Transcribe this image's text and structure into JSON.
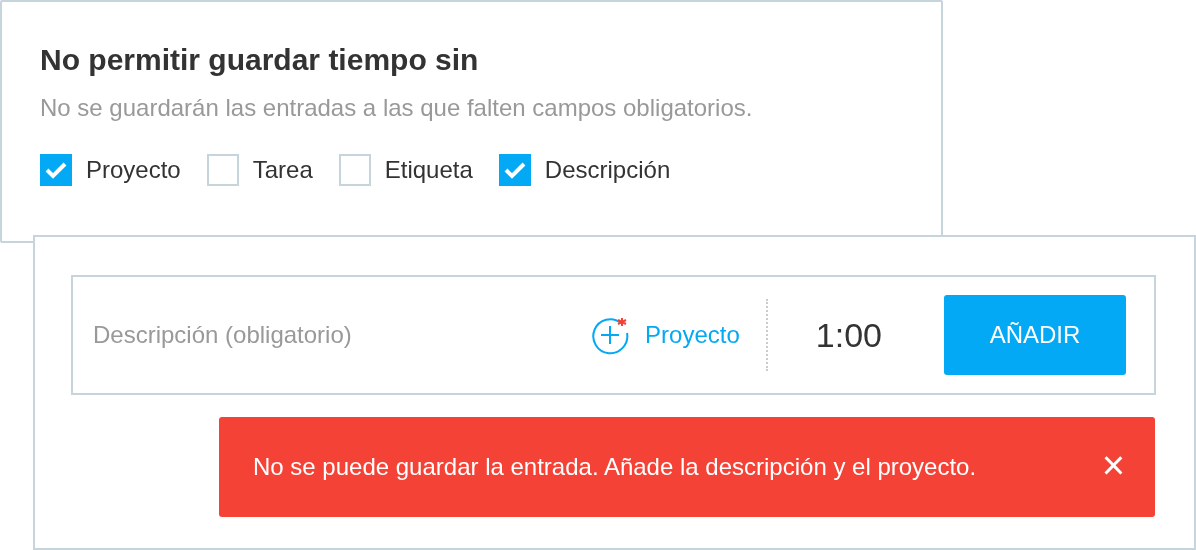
{
  "settings": {
    "title": "No permitir guardar tiempo sin",
    "subtitle": "No se guardarán las entradas a las que falten campos obligatorios.",
    "options": [
      {
        "label": "Proyecto",
        "checked": true
      },
      {
        "label": "Tarea",
        "checked": false
      },
      {
        "label": "Etiqueta",
        "checked": false
      },
      {
        "label": "Descripción",
        "checked": true
      }
    ]
  },
  "entry": {
    "description": {
      "placeholder": "Descripción (obligatorio)"
    },
    "project": {
      "label": "Proyecto",
      "required": true
    },
    "duration": "1:00",
    "button": "AÑADIR"
  },
  "error": {
    "message": "No se puede guardar la entrada. Añade la descripción y el proyecto.",
    "close": "×"
  }
}
